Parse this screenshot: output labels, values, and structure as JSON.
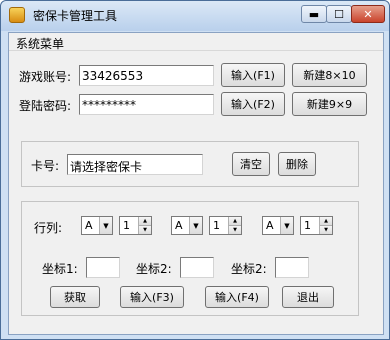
{
  "window": {
    "title": "密保卡管理工具",
    "minimize_label": "▬",
    "maximize_label": "☐",
    "close_label": "✕"
  },
  "menu": {
    "system_menu": "系统菜单"
  },
  "account": {
    "game_account_label": "游戏账号:",
    "game_account_value": "33426553",
    "input_f1": "输入(F1)",
    "new_8x10": "新建8×10",
    "login_password_label": "登陆密码:",
    "login_password_value": "*********",
    "input_f2": "输入(F2)",
    "new_9x9": "新建9×9"
  },
  "card": {
    "card_label": "卡号:",
    "card_value": "请选择密保卡",
    "clear_button": "清空",
    "delete_button": "删除"
  },
  "coords": {
    "row_col_label": "行列:",
    "selects": [
      "A",
      "A",
      "A"
    ],
    "spins": [
      "1",
      "1",
      "1"
    ],
    "coord1_label": "坐标1:",
    "coord2_label": "坐标2:",
    "coord3_label": "坐标2:",
    "get_button": "获取",
    "input_f3": "输入(F3)",
    "input_f4": "输入(F4)",
    "exit_button": "退出"
  }
}
